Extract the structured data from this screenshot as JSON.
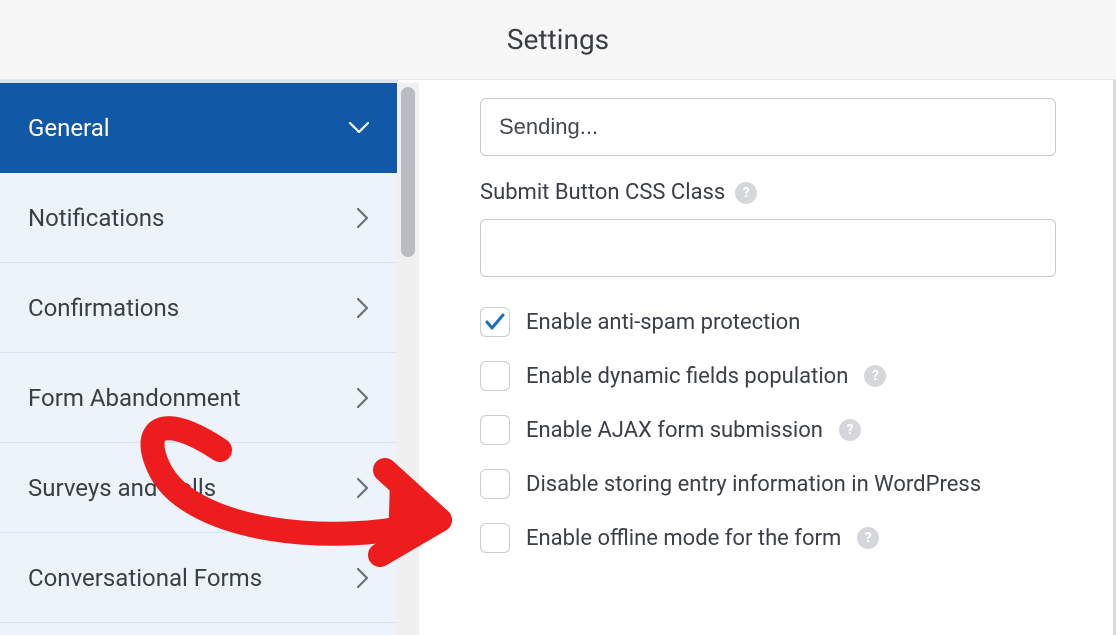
{
  "header": {
    "title": "Settings"
  },
  "sidebar": {
    "items": [
      {
        "label": "General",
        "active": true,
        "expanded": true
      },
      {
        "label": "Notifications",
        "active": false
      },
      {
        "label": "Confirmations",
        "active": false
      },
      {
        "label": "Form Abandonment",
        "active": false
      },
      {
        "label": "Surveys and Polls",
        "active": false
      },
      {
        "label": "Conversational Forms",
        "active": false
      }
    ]
  },
  "main": {
    "sending_value": "Sending...",
    "css_class_label": "Submit Button CSS Class",
    "css_class_value": "",
    "checks": [
      {
        "label": "Enable anti-spam protection",
        "checked": true,
        "help": false
      },
      {
        "label": "Enable dynamic fields population",
        "checked": false,
        "help": true
      },
      {
        "label": "Enable AJAX form submission",
        "checked": false,
        "help": true
      },
      {
        "label": "Disable storing entry information in WordPress",
        "checked": false,
        "help": false
      },
      {
        "label": "Enable offline mode for the form",
        "checked": false,
        "help": true
      }
    ]
  }
}
